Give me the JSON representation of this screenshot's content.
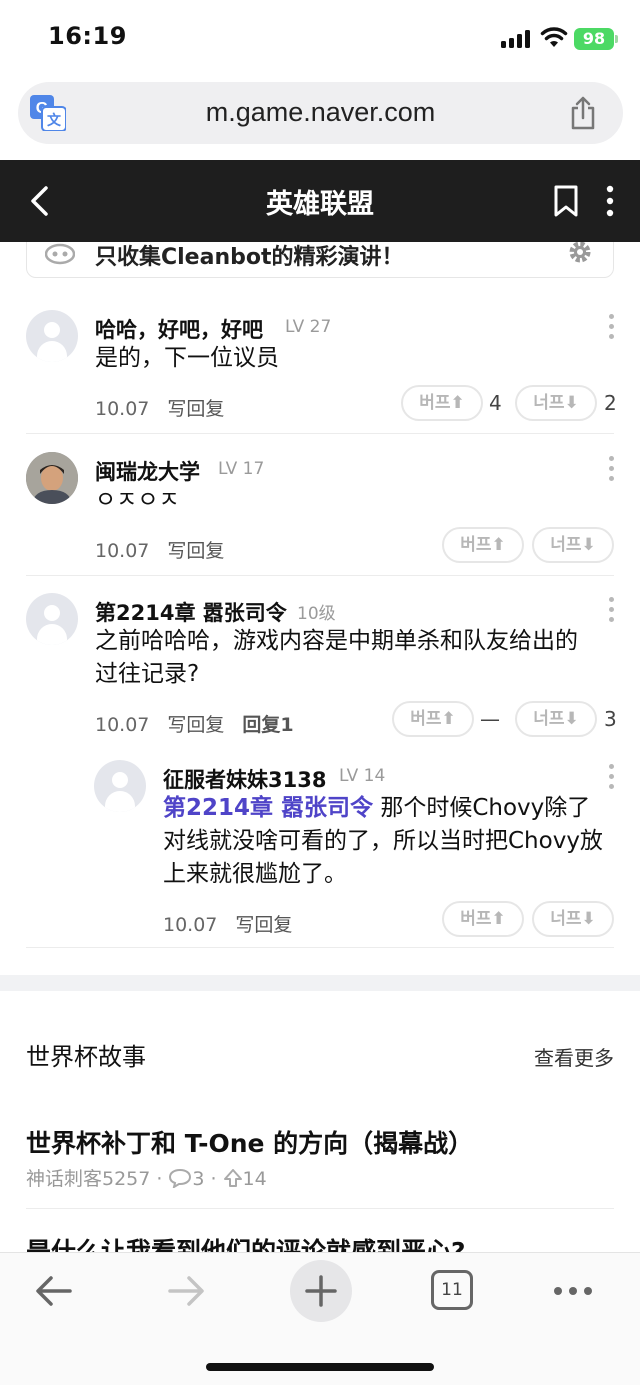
{
  "status": {
    "time": "16:19",
    "battery": "98"
  },
  "browser": {
    "url": "m.game.naver.com",
    "tabs_count": "11"
  },
  "header": {
    "title": "英雄联盟"
  },
  "cleanbot": {
    "text": "只收集Cleanbot的精彩演讲！"
  },
  "vote_labels": {
    "up": "버프⬆",
    "down": "너프⬇"
  },
  "comments": [
    {
      "author": "哈哈，好吧，好吧",
      "level": "LV 27",
      "text": "是的，下一位议员",
      "date": "10.07",
      "reply": "写回复",
      "up_count": "4",
      "down_count": "2"
    },
    {
      "author": "闽瑞龙大学",
      "level": "LV 17",
      "text": "ㅇㅈㅇㅈ",
      "date": "10.07",
      "reply": "写回复"
    },
    {
      "author": "第2214章 嚣张司令",
      "level": "10级",
      "text": "之前哈哈哈，游戏内容是中期单杀和队友给出的过往记录?",
      "date": "10.07",
      "reply": "写回复",
      "reply_count": "回复1",
      "up_count": "—",
      "down_count": "3"
    }
  ],
  "reply": {
    "author": "征服者妹妹3138",
    "level": "LV 14",
    "mention": "第2214章 嚣张司令",
    "text": " 那个时候Chovy除了对线就没啥可看的了，所以当时把Chovy放上来就很尴尬了。",
    "date": "10.07",
    "reply": "写回复"
  },
  "section": {
    "title": "世界杯故事",
    "more": "查看更多",
    "stories": [
      {
        "title": "世界杯补丁和 T-One 的方向（揭幕战）",
        "author": "神话刺客5257",
        "comments": "3",
        "upvotes": "14"
      },
      {
        "title": "是什么让我看到他们的评论就感到恶心?"
      }
    ]
  }
}
